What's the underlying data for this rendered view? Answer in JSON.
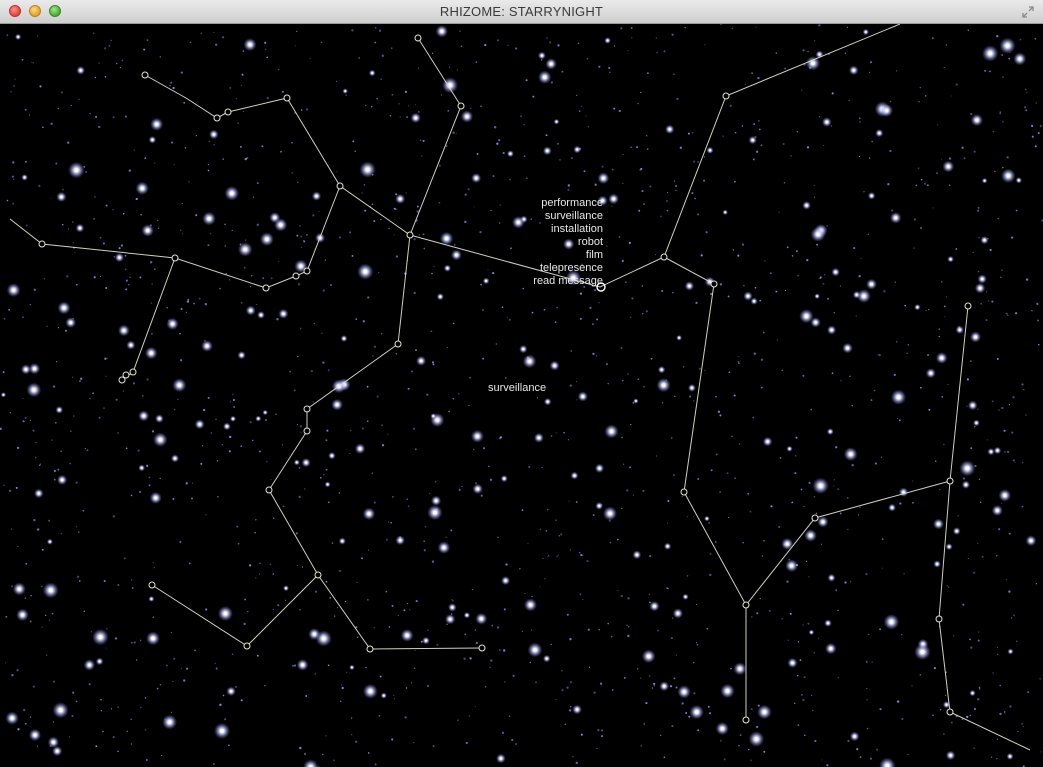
{
  "window": {
    "title": "RHIZOME: STARRYNIGHT"
  },
  "colors": {
    "sky": "#000000",
    "line": "#e6e6d6",
    "star": "#cfd2ff",
    "label": "#e8e8e8"
  },
  "context_menu": {
    "items": [
      "performance",
      "surveillance",
      "installation",
      "robot",
      "film",
      "telepresence",
      "read message"
    ]
  },
  "floating_label": "surveillance"
}
